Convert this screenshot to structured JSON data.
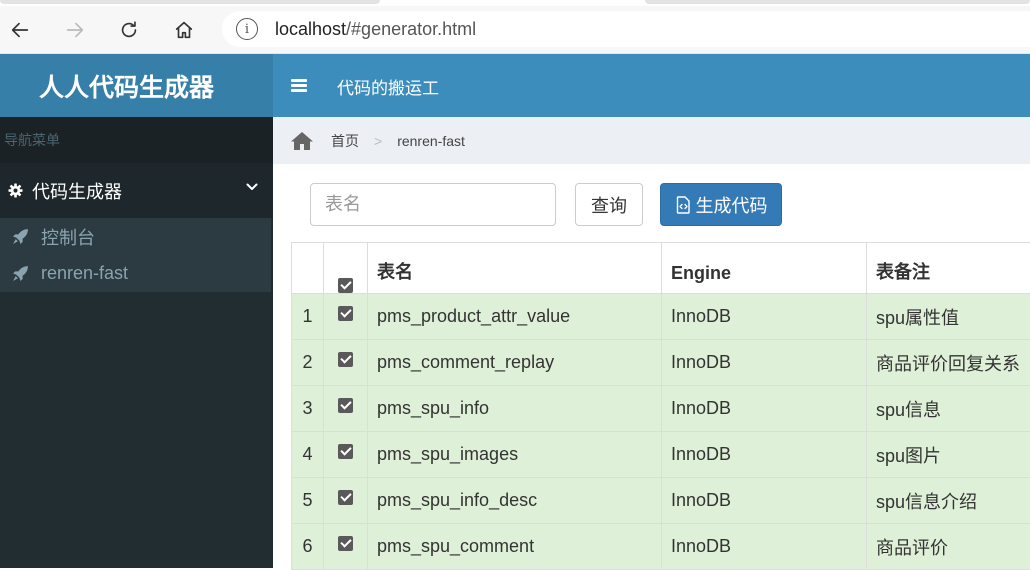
{
  "browser": {
    "url_host": "localhost",
    "url_path": "/#generator.html"
  },
  "app": {
    "logo": "人人代码生成器",
    "header_title": "代码的搬运工"
  },
  "sidebar": {
    "header": "导航菜单",
    "tree_label": "代码生成器",
    "items": [
      {
        "label": "控制台"
      },
      {
        "label": "renren-fast"
      }
    ]
  },
  "breadcrumb": {
    "home": "首页",
    "separator": ">",
    "current": "renren-fast"
  },
  "toolbar": {
    "search_placeholder": "表名",
    "query_label": "查询",
    "generate_label": "生成代码"
  },
  "table": {
    "headers": [
      "表名",
      "Engine",
      "表备注"
    ],
    "rows": [
      {
        "num": "1",
        "name": "pms_product_attr_value",
        "engine": "InnoDB",
        "comment": "spu属性值"
      },
      {
        "num": "2",
        "name": "pms_comment_replay",
        "engine": "InnoDB",
        "comment": "商品评价回复关系"
      },
      {
        "num": "3",
        "name": "pms_spu_info",
        "engine": "InnoDB",
        "comment": "spu信息"
      },
      {
        "num": "4",
        "name": "pms_spu_images",
        "engine": "InnoDB",
        "comment": "spu图片"
      },
      {
        "num": "5",
        "name": "pms_spu_info_desc",
        "engine": "InnoDB",
        "comment": "spu信息介绍"
      },
      {
        "num": "6",
        "name": "pms_spu_comment",
        "engine": "InnoDB",
        "comment": "商品评价"
      }
    ]
  },
  "colors": {
    "header_blue": "#3c8dbc",
    "logo_blue": "#367fa9",
    "sidebar_dark": "#222d32",
    "row_selected": "#dff0d8",
    "primary_button": "#337ab7"
  }
}
